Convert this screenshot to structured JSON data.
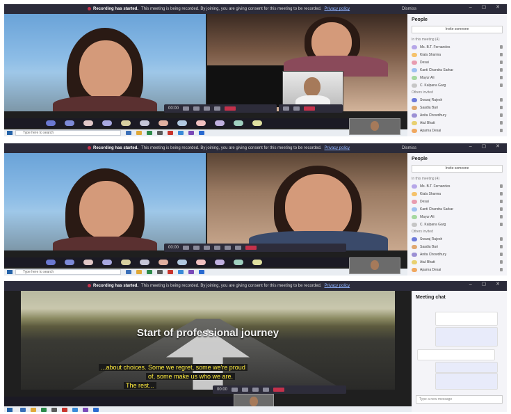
{
  "banner": {
    "title": "Recording has started.",
    "message": "This meeting is being recorded. By joining, you are giving consent for this meeting to be recorded.",
    "link": "Privacy policy",
    "dismiss": "Dismiss"
  },
  "window_controls": "– ▢ ✕",
  "call": {
    "timer": "00:00",
    "tile_a_name": "",
    "tile_b_name": ""
  },
  "taskbar": {
    "search_placeholder": "Type here to search"
  },
  "people_panel": {
    "title": "People",
    "invite_label": "Invite someone",
    "in_meeting_label": "In this meeting (4)",
    "suggestions_label": "Others invited",
    "in_meeting": [
      {
        "name": "Ms. B.T. Fernandes",
        "color": "#b6a6e8"
      },
      {
        "name": "Kiala Sharma",
        "color": "#f5c26b"
      },
      {
        "name": "Desai",
        "color": "#e89cb0"
      },
      {
        "name": "Kanti Chandra Sarkar",
        "color": "#9ec0f0"
      },
      {
        "name": "Mayur Ali",
        "color": "#a6d8a0"
      },
      {
        "name": "C. Kalpana Garg",
        "color": "#c6c6c6"
      }
    ],
    "others": [
      {
        "name": "Swaraj Rajesh",
        "color": "#6e7bd9"
      },
      {
        "name": "Saadia Bari",
        "color": "#e0a870"
      },
      {
        "name": "Anita Chowdhury",
        "color": "#9b8fd4"
      },
      {
        "name": "Atul Bhatt",
        "color": "#e8d070"
      },
      {
        "name": "Aparna Desai",
        "color": "#f0a860"
      }
    ]
  },
  "presentation": {
    "slide_title": "Start of professional journey",
    "captions": [
      "...about choices. Some we regret, some we're proud",
      "of, some make us who we are.",
      "The rest..."
    ]
  },
  "chat_panel": {
    "title": "Meeting chat",
    "compose_placeholder": "Type a new message"
  },
  "tray_icons": [
    "#6a78d1",
    "#7d8ad8",
    "#e2c8c8",
    "#a8a8e0",
    "#d8d0a0",
    "#c7c7d8",
    "#e0b0a0",
    "#b0c8e0",
    "#f0c0c0",
    "#c0b0e0",
    "#a0d0c0",
    "#e0e0a0"
  ],
  "taskbar_icons": [
    "#3a6fb8",
    "#e0a838",
    "#2d8a4a",
    "#5a5a5a",
    "#c8342c",
    "#3a8ad8",
    "#7a4ab8",
    "#2a6ad0"
  ]
}
